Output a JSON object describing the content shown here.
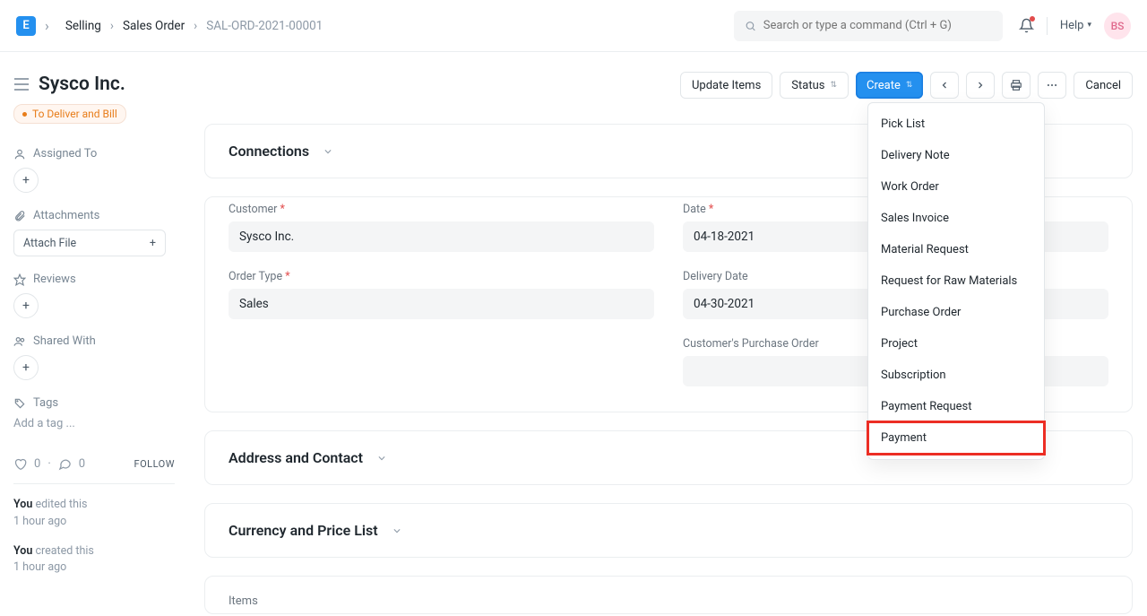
{
  "navbar": {
    "logo_text": "E",
    "breadcrumb": {
      "b1": "Selling",
      "b2": "Sales Order",
      "current": "SAL-ORD-2021-00001"
    },
    "search_placeholder": "Search or type a command (Ctrl + G)",
    "help_label": "Help",
    "avatar_initials": "BS"
  },
  "title": {
    "doc_title": "Sysco Inc.",
    "status_label": "To Deliver and Bill"
  },
  "actions": {
    "update_items": "Update Items",
    "status": "Status",
    "create": "Create",
    "cancel": "Cancel"
  },
  "create_menu": {
    "items": {
      "0": "Pick List",
      "1": "Delivery Note",
      "2": "Work Order",
      "3": "Sales Invoice",
      "4": "Material Request",
      "5": "Request for Raw Materials",
      "6": "Purchase Order",
      "7": "Project",
      "8": "Subscription",
      "9": "Payment Request",
      "10": "Payment"
    },
    "highlighted_index": 10
  },
  "sidebar": {
    "assigned_to": "Assigned To",
    "attachments": "Attachments",
    "attach_file": "Attach File",
    "reviews": "Reviews",
    "shared_with": "Shared With",
    "tags": "Tags",
    "add_tag": "Add a tag ...",
    "likes": "0",
    "comments": "0",
    "follow": "FOLLOW",
    "activity": {
      "a1_actor": "You",
      "a1_verb": "edited this",
      "a1_time": "1 hour ago",
      "a2_actor": "You",
      "a2_verb": "created this",
      "a2_time": "1 hour ago"
    }
  },
  "sections": {
    "connections": "Connections",
    "address": "Address and Contact",
    "currency": "Currency and Price List",
    "items": "Items"
  },
  "form": {
    "customer_label": "Customer",
    "customer_value": "Sysco Inc.",
    "order_type_label": "Order Type",
    "order_type_value": "Sales",
    "date_label": "Date",
    "date_value": "04-18-2021",
    "delivery_date_label": "Delivery Date",
    "delivery_date_value": "04-30-2021",
    "cpo_label": "Customer's Purchase Order",
    "cpo_value": ""
  }
}
